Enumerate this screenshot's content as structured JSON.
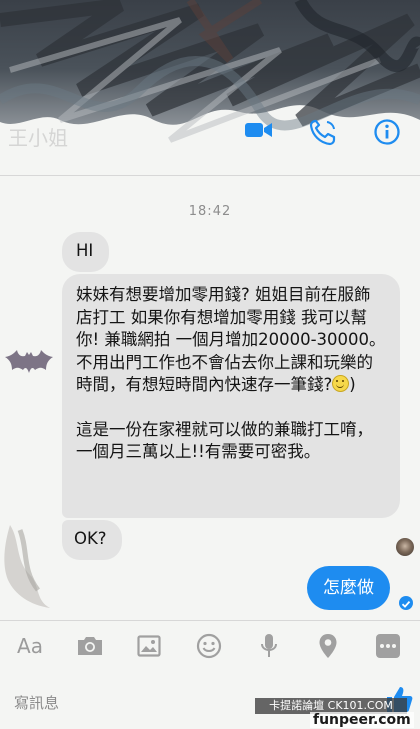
{
  "header": {
    "contact_name": "王小姐",
    "icons": [
      "video-call-icon",
      "phone-call-icon",
      "info-icon"
    ],
    "accent_color": "#1e8cf0"
  },
  "conversation": {
    "timestamp": "18:42",
    "messages": [
      {
        "from": "them",
        "text": "HI"
      },
      {
        "from": "them",
        "paragraphs": [
          "妹妹有想要增加零用錢? 姐姐目前在服飾店打工 如果你有想增加零用錢 我可以幫你! 兼職網拍 一個月增加20000-30000。不用出門工作也不會佔去你上課和玩樂的時間，有想短時間內快速存一筆錢?",
          ")",
          "這是一份在家裡就可以做的兼職打工唷， 一個月三萬以上!!有需要可密我。"
        ]
      },
      {
        "from": "them",
        "text": "OK?"
      },
      {
        "from": "me",
        "text": "怎麼做"
      }
    ]
  },
  "toolbar": {
    "aa_label": "Aa",
    "icons": [
      "camera-icon",
      "photo-icon",
      "emoji-icon",
      "microphone-icon",
      "location-icon",
      "more-icon"
    ]
  },
  "composer": {
    "placeholder": "寫訊息"
  },
  "watermark": {
    "line1": "卡提諾論壇 CK101.COM",
    "line2": "funpeer.com"
  }
}
